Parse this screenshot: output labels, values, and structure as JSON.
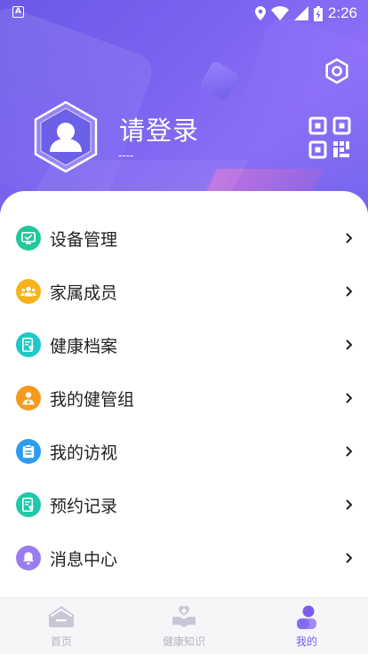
{
  "status_bar": {
    "time": "2:26",
    "notification_letter": "A"
  },
  "header": {
    "login_title": "请登录",
    "login_subtitle": "----"
  },
  "menu": {
    "items": [
      {
        "label": "设备管理",
        "icon": "device-monitor-icon",
        "color": "#22c89a"
      },
      {
        "label": "家属成员",
        "icon": "family-members-icon",
        "color": "#f7b21c"
      },
      {
        "label": "健康档案",
        "icon": "health-record-icon",
        "color": "#1ec8c8"
      },
      {
        "label": "我的健管组",
        "icon": "care-team-icon",
        "color": "#f59a1e"
      },
      {
        "label": "我的访视",
        "icon": "clipboard-visit-icon",
        "color": "#2e9bf0"
      },
      {
        "label": "预约记录",
        "icon": "appointment-record-icon",
        "color": "#1ec8a8"
      },
      {
        "label": "消息中心",
        "icon": "bell-icon",
        "color": "#9a7cf0"
      }
    ]
  },
  "bottom_nav": {
    "items": [
      {
        "label": "首页",
        "icon": "home-icon",
        "active": false
      },
      {
        "label": "健康知识",
        "icon": "health-knowledge-icon",
        "active": false
      },
      {
        "label": "我的",
        "icon": "profile-icon",
        "active": true
      }
    ]
  },
  "colors": {
    "accent": "#7a5cf0",
    "header_gradient_start": "#6a59e6",
    "header_gradient_end": "#8b6ef5",
    "inactive_nav": "#b5b5bd"
  }
}
